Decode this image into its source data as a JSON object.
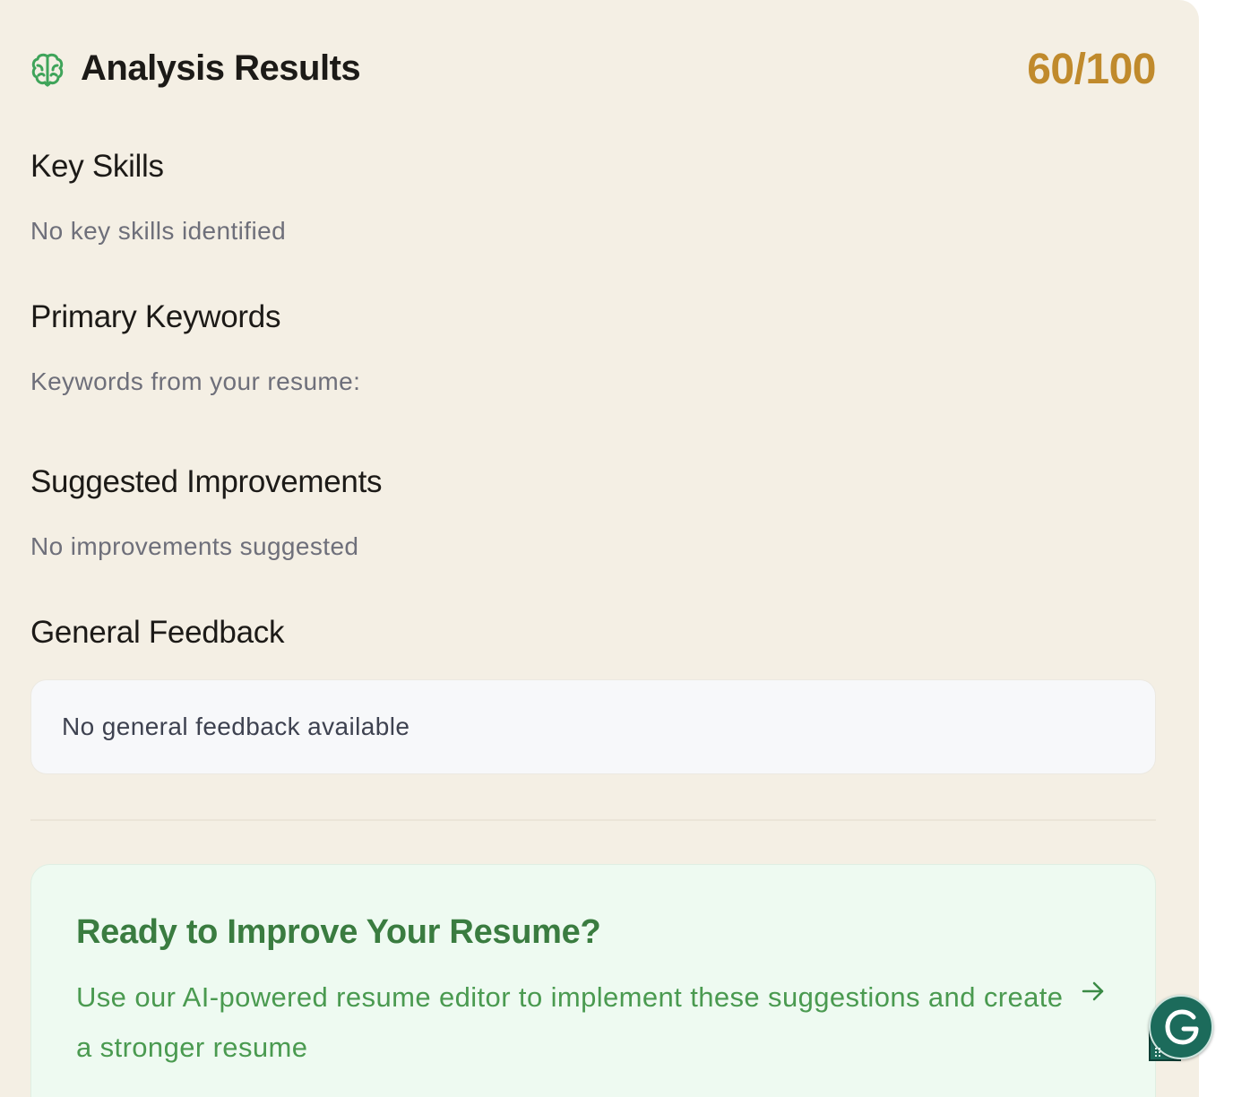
{
  "header": {
    "title": "Analysis Results",
    "score": "60/100",
    "icon": "brain-icon"
  },
  "sections": {
    "key_skills": {
      "heading": "Key Skills",
      "body": "No key skills identified"
    },
    "primary_keywords": {
      "heading": "Primary Keywords",
      "body": "Keywords from your resume:"
    },
    "suggested_improvements": {
      "heading": "Suggested Improvements",
      "body": "No improvements suggested"
    },
    "general_feedback": {
      "heading": "General Feedback",
      "body": "No general feedback available"
    }
  },
  "cta": {
    "title": "Ready to Improve Your Resume?",
    "description": "Use our AI-powered resume editor to implement these suggestions and create a stronger resume",
    "icon": "arrow-right-icon"
  },
  "widgets": {
    "grammarly_icon": "grammarly-icon"
  },
  "colors": {
    "panel_background": "#f4efe4",
    "score": "#c08a2c",
    "accent_green": "#3a7c40",
    "cta_background": "#eefaf1",
    "icon_green": "#3fa45a",
    "grammarly": "#1c6b5b"
  }
}
